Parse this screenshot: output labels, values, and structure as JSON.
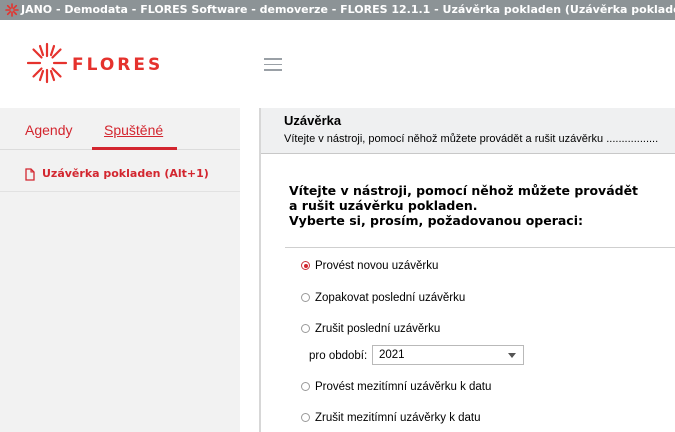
{
  "window": {
    "title": "JANO - Demodata - FLORES Software - demoverze - FLORES 12.1.1 - Uzávěrka pokladen  (Uzávěrka pokladen)"
  },
  "brand": {
    "logo_text": "FLORES",
    "accent_color": "#d3262f"
  },
  "sidebar": {
    "tabs": [
      {
        "label": "Agendy",
        "active": false
      },
      {
        "label": "Spuštěné",
        "active": true
      }
    ],
    "items": [
      {
        "label": "Uzávěrka pokladen (Alt+1)",
        "icon": "document-icon"
      }
    ]
  },
  "main": {
    "title": "Uzávěrka",
    "subtitle": "Vítejte v nástroji, pomocí něhož můžete provádět a rušit uzávěrku .................",
    "intro_lines": [
      "Vítejte v nástroji, pomocí něhož můžete provádět",
      "a rušit uzávěrku pokladen.",
      "Vyberte si, prosím, požadovanou operaci:"
    ],
    "options": [
      {
        "label": "Provést novou uzávěrku",
        "checked": true
      },
      {
        "label": "Zopakovat poslední uzávěrku",
        "checked": false
      },
      {
        "label": "Zrušit poslední uzávěrku",
        "checked": false
      },
      {
        "label": "Provést mezitímní uzávěrku k datu",
        "checked": false
      },
      {
        "label": "Zrušit mezitímní uzávěrky k datu",
        "checked": false
      }
    ],
    "period": {
      "label": "pro období:",
      "value": "2021"
    }
  }
}
